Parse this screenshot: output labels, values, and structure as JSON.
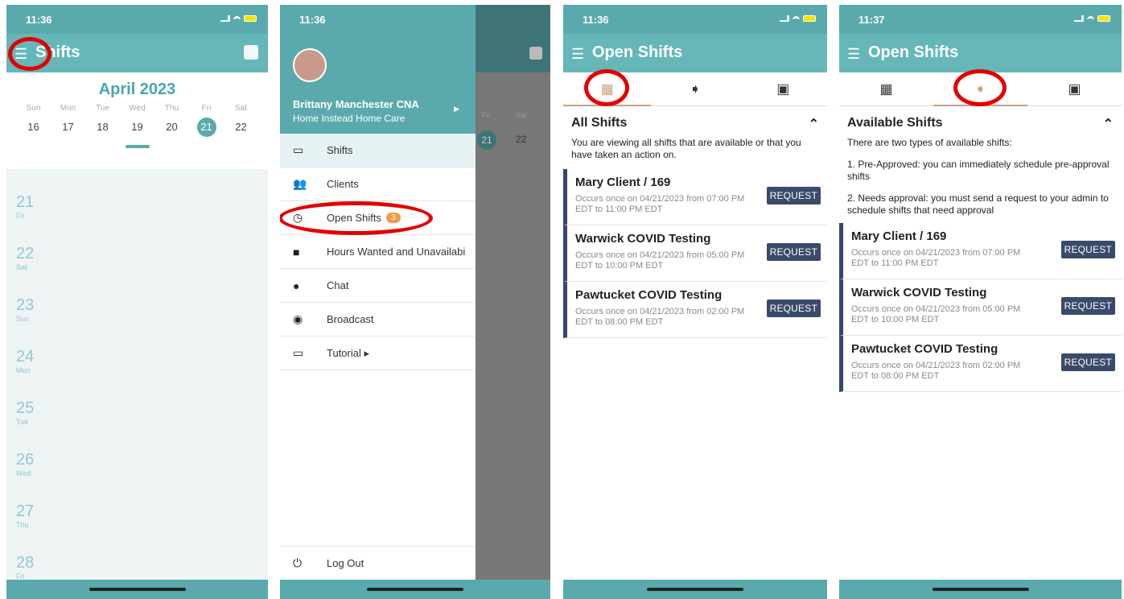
{
  "phone1": {
    "time": "11:36",
    "title": "Shifts",
    "month": "April 2023",
    "week": [
      {
        "day": "Sun",
        "num": "16"
      },
      {
        "day": "Mon",
        "num": "17"
      },
      {
        "day": "Tue",
        "num": "18"
      },
      {
        "day": "Wed",
        "num": "19"
      },
      {
        "day": "Thu",
        "num": "20"
      },
      {
        "day": "Fri",
        "num": "21"
      },
      {
        "day": "Sat",
        "num": "22"
      }
    ],
    "days": [
      {
        "num": "21",
        "wd": "Fri"
      },
      {
        "num": "22",
        "wd": "Sat"
      },
      {
        "num": "23",
        "wd": "Sun"
      },
      {
        "num": "24",
        "wd": "Mon"
      },
      {
        "num": "25",
        "wd": "Tue"
      },
      {
        "num": "26",
        "wd": "Wed"
      },
      {
        "num": "27",
        "wd": "Thu"
      },
      {
        "num": "28",
        "wd": "Fri"
      }
    ]
  },
  "phone2": {
    "time": "11:36",
    "user_name": "Brittany Manchester CNA",
    "org": "Home Instead Home Care",
    "menu": {
      "shifts": "Shifts",
      "clients": "Clients",
      "open_shifts": "Open Shifts",
      "open_count": "3",
      "hours": "Hours Wanted and Unavailabi",
      "chat": "Chat",
      "broadcast": "Broadcast",
      "tutorial": "Tutorial ▸",
      "logout": "Log Out"
    },
    "bg_days": {
      "fri": "Fri",
      "sat": "Sat",
      "n21": "21",
      "n22": "22"
    }
  },
  "phone3": {
    "time": "11:36",
    "title": "Open Shifts",
    "section": "All Shifts",
    "desc": "You are viewing all shifts that are available or that you have taken an action on.",
    "shifts": [
      {
        "title": "Mary Client / 169",
        "sub": "Occurs once on 04/21/2023 from 07:00 PM EDT to 11:00 PM EDT",
        "btn": "REQUEST"
      },
      {
        "title": "Warwick COVID Testing",
        "sub": "Occurs once on 04/21/2023 from 05:00 PM EDT to 10:00 PM EDT",
        "btn": "REQUEST"
      },
      {
        "title": "Pawtucket COVID Testing",
        "sub": "Occurs once on 04/21/2023 from 02:00 PM EDT to 08:00 PM EDT",
        "btn": "REQUEST"
      }
    ]
  },
  "phone4": {
    "time": "11:37",
    "title": "Open Shifts",
    "section": "Available Shifts",
    "desc1": "There are two types of available shifts:",
    "desc2": "1. Pre-Approved: you can immediately schedule pre-approval shifts",
    "desc3": "2. Needs approval: you must send a request to your admin to schedule shifts that need approval",
    "shifts": [
      {
        "title": "Mary Client / 169",
        "sub": "Occurs once on 04/21/2023 from 07:00 PM EDT to 11:00 PM EDT",
        "btn": "REQUEST"
      },
      {
        "title": "Warwick COVID Testing",
        "sub": "Occurs once on 04/21/2023 from 05:00 PM EDT to 10:00 PM EDT",
        "btn": "REQUEST"
      },
      {
        "title": "Pawtucket COVID Testing",
        "sub": "Occurs once on 04/21/2023 from 02:00 PM EDT to 08:00 PM EDT",
        "btn": "REQUEST"
      }
    ]
  },
  "colors": {
    "teal": "#65b7b9",
    "navy": "#3a4a6a",
    "highlight": "#e30000"
  }
}
